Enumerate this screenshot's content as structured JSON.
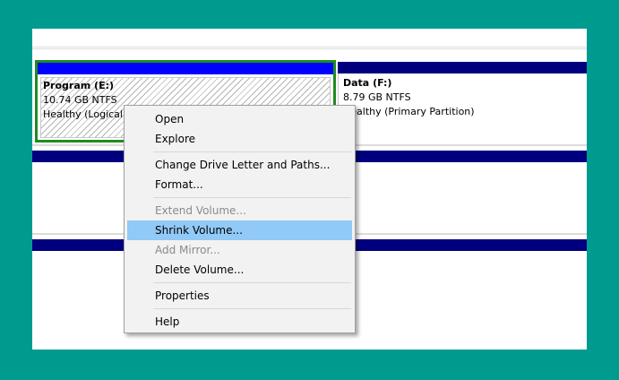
{
  "partitions": [
    {
      "name": "Program  (E:)",
      "size": "10.74 GB NTFS",
      "status": "Healthy (Logical",
      "bar_color": "#0000ff",
      "selected": true
    },
    {
      "name": "Data  (F:)",
      "size": "8.79 GB NTFS",
      "status": "Healthy (Primary Partition)",
      "bar_color": "#00007f",
      "selected": false
    }
  ],
  "context_menu": {
    "items": [
      {
        "label": "Open",
        "enabled": true
      },
      {
        "label": "Explore",
        "enabled": true
      },
      {
        "label": "Change Drive Letter and Paths...",
        "enabled": true
      },
      {
        "label": "Format...",
        "enabled": true
      },
      {
        "label": "Extend Volume...",
        "enabled": false
      },
      {
        "label": "Shrink Volume...",
        "enabled": true,
        "highlighted": true
      },
      {
        "label": "Add Mirror...",
        "enabled": false
      },
      {
        "label": "Delete Volume...",
        "enabled": true
      },
      {
        "label": "Properties",
        "enabled": true
      },
      {
        "label": "Help",
        "enabled": true
      }
    ]
  },
  "colors": {
    "background": "#009b8f",
    "disk_band": "#00007f",
    "selected_partition_border": "#1e8c1e",
    "menu_highlight": "#91c9f7"
  }
}
